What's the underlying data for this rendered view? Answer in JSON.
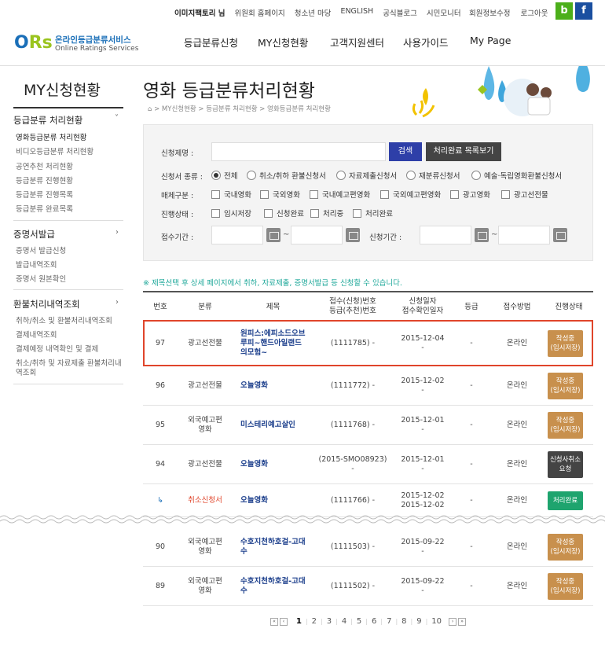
{
  "top": {
    "links": [
      "이미지팩토리 님",
      "위원회 홈페이지",
      "청소년 마당",
      "ENGLISH",
      "공식블로그",
      "시민모니터"
    ],
    "right": [
      "회원정보수정",
      "로그아웃"
    ],
    "b_icon": "b",
    "f_icon": "f"
  },
  "logo": {
    "mark": "ORs",
    "korean": "온라인등급분류서비스",
    "english": "Online Ratings Services"
  },
  "gnb": [
    "등급분류신청",
    "MY신청현황",
    "고객지원센터",
    "사용가이드",
    "My Page"
  ],
  "lnb": {
    "title": "MY신청현황",
    "sections": [
      {
        "label": "등급분류 처리현황",
        "arrow": "˅",
        "items": [
          "영화등급분류 처리현황",
          "비디오등급분류 처리현황",
          "공연추천 처리현황",
          "등급분류 진행현황",
          "등급분류 진행목록",
          "등급분류 완료목록"
        ]
      },
      {
        "label": "증명서발급",
        "arrow": "›",
        "items": [
          "증명서 발급신청",
          "발급내역조회",
          "증명서 원본확인"
        ]
      },
      {
        "label": "환불처리내역조회",
        "arrow": "›",
        "items": [
          "취하/취소 및 환불처리내역조회",
          "결제내역조회",
          "결제예정 내역확인 및 결제",
          "취소/취하 및 자료제출 환불처리내",
          "역조회"
        ]
      }
    ]
  },
  "page": {
    "title": "영화 등급분류처리현황",
    "breadcrumb": "⌂  >  MY신청현황  >  등급분류 처리현황  >  영화등급분류 처리현황"
  },
  "search": {
    "name_label": "신청제명 :",
    "search_btn": "검색",
    "done_list_btn": "처리완료 목록보기",
    "type_label": "신청서 종류 :",
    "type_options": [
      "전체",
      "취소/취하 환불신청서",
      "자료제출신청서",
      "재분류신청서",
      "예술·독립영화환불신청서"
    ],
    "media_label": "매체구분 :",
    "media_options": [
      "국내영화",
      "국외영화",
      "국내예고편영화",
      "국외예고편영화",
      "광고영화",
      "광고선전물"
    ],
    "status_label": "진행상태 :",
    "status_options": [
      "임시저장",
      "신청완료",
      "처리중",
      "처리완료"
    ],
    "recv_label": "접수기간 :",
    "apply_label": "신청기간 :",
    "tilde": "~"
  },
  "notice": "※ 제목선택 후 상세 페이지에서 취하, 자료제출, 증명서발급 등 신청할 수 있습니다.",
  "table": {
    "headers": [
      "번호",
      "분류",
      "제목",
      "접수(신청)번호\n등급(추천)번호",
      "신청일자\n접수확인일자",
      "등급",
      "접수방법",
      "진행상태"
    ],
    "rows": [
      {
        "no": "97",
        "cat": "광고선전물",
        "title": "원피스:에피소드오브\n루피~핸드아일랜드\n의모험~",
        "num": "(1111785) -",
        "date": "2015-12-04\n-",
        "grade": "-",
        "method": "온라인",
        "status": "작성중\n(임시저장)"
      },
      {
        "no": "96",
        "cat": "광고선전물",
        "title": "오늘영화",
        "num": "(1111772) -",
        "date": "2015-12-02\n-",
        "grade": "-",
        "method": "온라인",
        "status": "작성중\n(임시저장)"
      },
      {
        "no": "95",
        "cat": "외국예고편\n영화",
        "title": "미스테리예고살인",
        "num": "(1111768) -",
        "date": "2015-12-01\n-",
        "grade": "-",
        "method": "온라인",
        "status": "작성중\n(임시저장)"
      },
      {
        "no": "94",
        "cat": "광고선전물",
        "title": "오늘영화",
        "num": "(2015-SMO08923)\n-",
        "date": "2015-12-01\n-",
        "grade": "-",
        "method": "온라인",
        "status": "신청사취소\n요청"
      },
      {
        "no": "↳",
        "cat": "취소신청서",
        "title": "오늘영화",
        "num": "(1111766) -",
        "date": "2015-12-02\n2015-12-02",
        "grade": "-",
        "method": "온라인",
        "status": "처리완료"
      },
      {
        "no": "90",
        "cat": "외국예고편\n영화",
        "title": "수호지천하호걸-고대\n수",
        "num": "(1111503) -",
        "date": "2015-09-22\n-",
        "grade": "-",
        "method": "온라인",
        "status": "작성중\n(임시저장)"
      },
      {
        "no": "89",
        "cat": "외국예고편\n영화",
        "title": "수호지천하호걸-고대\n수",
        "num": "(1111502) -",
        "date": "2015-09-22\n-",
        "grade": "-",
        "method": "온라인",
        "status": "작성중\n(임시저장)"
      }
    ]
  },
  "pager": {
    "first": "«",
    "prev": "‹",
    "pages": [
      "1",
      "2",
      "3",
      "4",
      "5",
      "6",
      "7",
      "8",
      "9",
      "10"
    ],
    "next": "›",
    "last": "»"
  },
  "colors": {
    "accent": "#2e3fa8",
    "highlight": "#e0452b",
    "badge_orange": "#c8904d",
    "badge_dark": "#444444",
    "badge_green": "#1ea46e",
    "notice": "#1fa89a"
  }
}
